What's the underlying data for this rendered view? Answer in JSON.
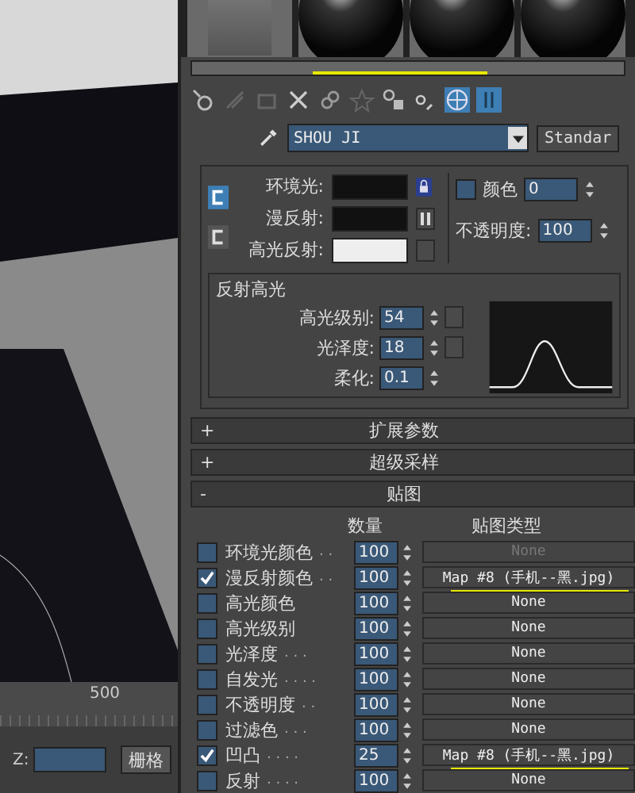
{
  "viewport": {
    "ruler_label": "500",
    "z_label": "Z:",
    "grid_button": "栅格"
  },
  "sample_slots": [
    {
      "kind": "cube"
    },
    {
      "kind": "sphere"
    },
    {
      "kind": "sphere"
    },
    {
      "kind": "sphere"
    }
  ],
  "material": {
    "name": "SHOU JI",
    "type_button": "Standar"
  },
  "basic": {
    "ambient_label": "环境光:",
    "diffuse_label": "漫反射:",
    "specular_label": "高光反射:",
    "self_illum": {
      "checked": false,
      "label": "颜色",
      "value": "0"
    },
    "opacity": {
      "label": "不透明度:",
      "value": "100"
    }
  },
  "highlights": {
    "title": "反射高光",
    "params": [
      {
        "label": "高光级别:",
        "value": "54",
        "map_button": true
      },
      {
        "label": "光泽度:",
        "value": "18",
        "map_button": true
      },
      {
        "label": "柔化:",
        "value": "0.1",
        "map_button": false
      }
    ]
  },
  "rollouts": [
    {
      "sign": "+",
      "title": "扩展参数"
    },
    {
      "sign": "+",
      "title": "超级采样"
    },
    {
      "sign": "-",
      "title": "贴图"
    }
  ],
  "maps": {
    "amount_header": "数量",
    "type_header": "贴图类型",
    "rows": [
      {
        "label": "环境光颜色",
        "dots": ". .",
        "checked": false,
        "amount": "100",
        "map": "None",
        "disabled": true,
        "underlined": false
      },
      {
        "label": "漫反射颜色",
        "dots": ". .",
        "checked": true,
        "amount": "100",
        "map": "Map #8 (手机--黑.jpg)",
        "disabled": false,
        "underlined": true
      },
      {
        "label": "高光颜色",
        "dots": "",
        "checked": false,
        "amount": "100",
        "map": "None",
        "disabled": false,
        "underlined": false
      },
      {
        "label": "高光级别",
        "dots": "",
        "checked": false,
        "amount": "100",
        "map": "None",
        "disabled": false,
        "underlined": false
      },
      {
        "label": "光泽度",
        "dots": ". . .",
        "checked": false,
        "amount": "100",
        "map": "None",
        "disabled": false,
        "underlined": false
      },
      {
        "label": "自发光",
        "dots": ". . . .",
        "checked": false,
        "amount": "100",
        "map": "None",
        "disabled": false,
        "underlined": false
      },
      {
        "label": "不透明度",
        "dots": ". .",
        "checked": false,
        "amount": "100",
        "map": "None",
        "disabled": false,
        "underlined": false
      },
      {
        "label": "过滤色",
        "dots": ". . .",
        "checked": false,
        "amount": "100",
        "map": "None",
        "disabled": false,
        "underlined": false
      },
      {
        "label": "凹凸",
        "dots": ". . . .",
        "checked": true,
        "amount": "25",
        "map": "Map #8 (手机--黑.jpg)",
        "disabled": false,
        "underlined": true
      },
      {
        "label": "反射",
        "dots": ". . . .",
        "checked": false,
        "amount": "100",
        "map": "None",
        "disabled": false,
        "underlined": false
      }
    ]
  }
}
